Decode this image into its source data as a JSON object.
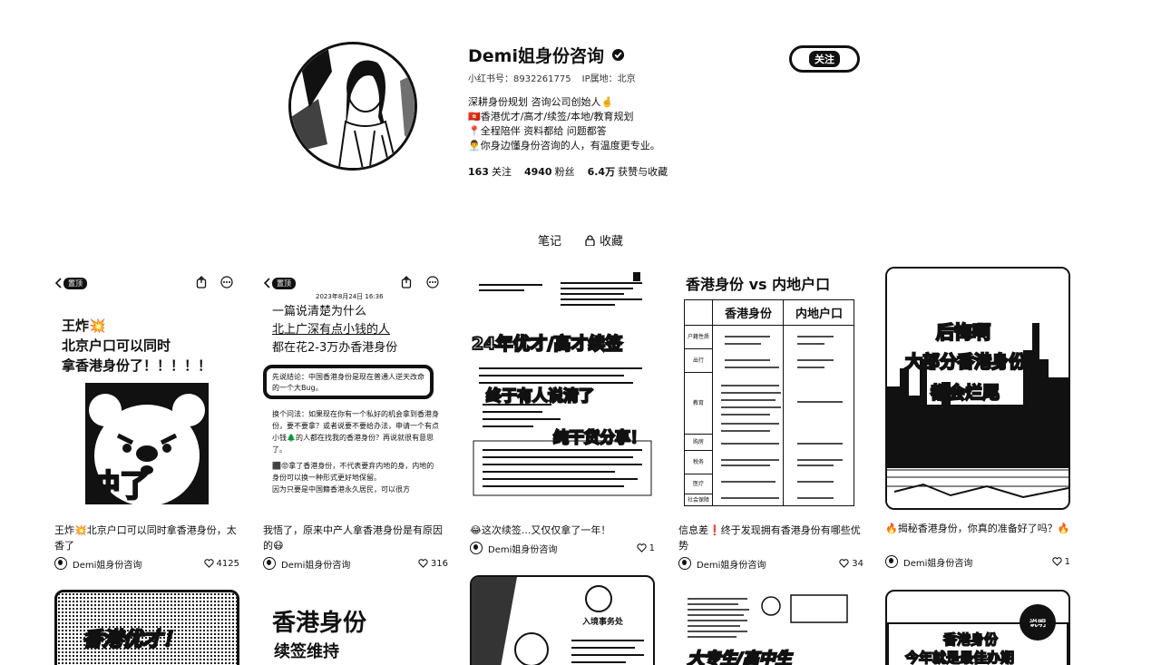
{
  "profile": {
    "name": "Demi姐身份咨询",
    "account_id": "小红书号：8932261775",
    "ip": "IP属地：北京",
    "bio": [
      "深耕身份规划 咨询公司创始人🤞",
      "🇭🇰香港优才/高才/续签/本地/教育规划",
      "📍全程陪伴 资料都给 问题都答",
      "👨‍💼你身边懂身份咨询的人，有温度更专业。"
    ],
    "stats": {
      "following_num": "163",
      "following_label": "关注",
      "followers_num": "4940",
      "followers_label": "粉丝",
      "likes_num": "6.4万",
      "likes_label": "获赞与收藏"
    },
    "follow_label": "关注"
  },
  "tabs": {
    "notes": "笔记",
    "collects": "收藏"
  },
  "cards": [
    {
      "caption": "王炸💥北京户口可以同时拿香港身份，太香了",
      "author": "Demi姐身份咨询",
      "likes": "4125",
      "cover": {
        "tag": "置顶",
        "line1": "王炸💥",
        "line2": "北京户口可以同时",
        "line3": "拿香港身份了！！！！！",
        "stamp": "冲了"
      }
    },
    {
      "caption": "我悟了，原来中产人拿香港身份是有原因的😷",
      "author": "Demi姐身份咨询",
      "likes": "316",
      "cover": {
        "tag": "置顶",
        "date": "2023年8月24日 16:36",
        "line1": "一篇说清楚为什么",
        "line2": "北上广深有点小钱的人",
        "line3": "都在花2-3万办香港身份",
        "box": "先说结论：中国香港身份是现在普通人逆天改命的一个大Bug。",
        "p1": "换个问法：如果现在你有一个私好的机会拿到香港身份，要不要拿？或者说要不要给办法，申请一个有点小钱🌲的人都在找我的香港身份？再说就很有意思了。",
        "p2": "⬛😡拿了香港身份，不代表要弃内地的身，内地的身份可以换一种形式更好地保留。",
        "p3": "因为只要是中国籍香港永久居民，可以很方"
      }
    },
    {
      "caption": "😂这次续签...又仅仅拿了一年！",
      "author": "Demi姐身份咨询",
      "likes": "1",
      "cover": {
        "line1": "24年优才/高才续签",
        "line2": "终于有人说清了",
        "line3": "纯干货分享！"
      }
    },
    {
      "caption": "信息差❗终于发现拥有香港身份有哪些优势",
      "author": "Demi姐身份咨询",
      "likes": "34",
      "cover": {
        "title": "香港身份 vs 内地户口",
        "col1": "香港身份",
        "col2": "内地户口",
        "rows": [
          "户籍性质",
          "出行",
          "教育",
          "购房",
          "税务",
          "医疗",
          "社会保障"
        ]
      }
    },
    {
      "caption": "🔥揭秘香港身份，你真的准备好了吗？🔥",
      "author": "Demi姐身份咨询",
      "likes": "1",
      "cover": {
        "line1": "后悔啊",
        "line2": "大部分香港身份",
        "line3": "都会烂尾"
      }
    }
  ],
  "second_row": [
    {
      "text": "香港优才！"
    },
    {
      "line1": "香港身份",
      "line2": "续签维持"
    },
    {
      "line1": "入境事务处"
    },
    {
      "line1": "大专生/高中生"
    },
    {
      "badge": "说明",
      "line1": "香港身份",
      "line2": "今年就是最佳办期"
    }
  ]
}
